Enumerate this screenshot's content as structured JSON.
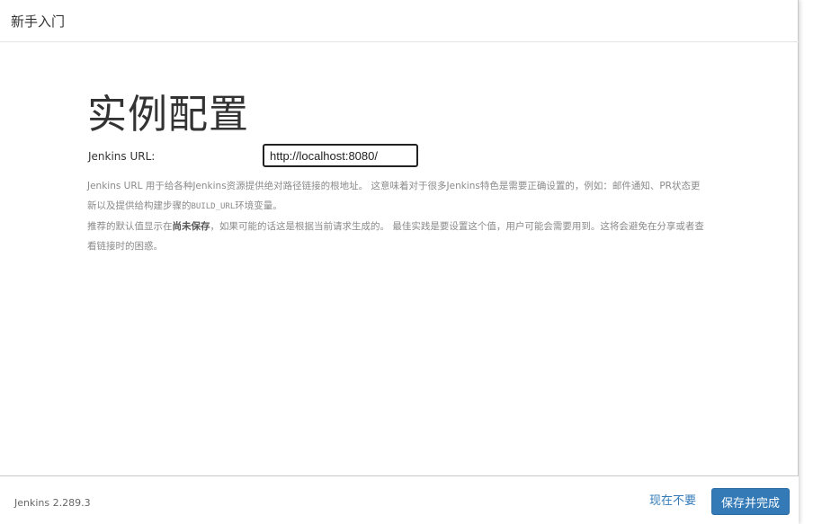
{
  "header": {
    "title": "新手入门"
  },
  "main": {
    "title": "实例配置",
    "url_label": "Jenkins URL:",
    "url_value": "http://localhost:8080/",
    "help_p1_a": "Jenkins URL 用于给各种Jenkins资源提供绝对路径链接的根地址。 这意味着对于很多Jenkins特色是需要正确设置的，例如：邮件通知、PR状态更新以及提供给构建步骤的",
    "help_p1_code": "BUILD_URL",
    "help_p1_b": "环境变量。",
    "help_p2_a": "推荐的默认值显示在",
    "help_p2_strong": "尚未保存",
    "help_p2_b": "，如果可能的话这是根据当前请求生成的。 最佳实践是要设置这个值，用户可能会需要用到。这将会避免在分享或者查看链接时的困惑。"
  },
  "footer": {
    "version": "Jenkins 2.289.3",
    "skip_label": "现在不要",
    "save_label": "保存并完成"
  },
  "colors": {
    "primary": "#337ab7",
    "text": "#333333",
    "muted": "#8a8a8a"
  }
}
